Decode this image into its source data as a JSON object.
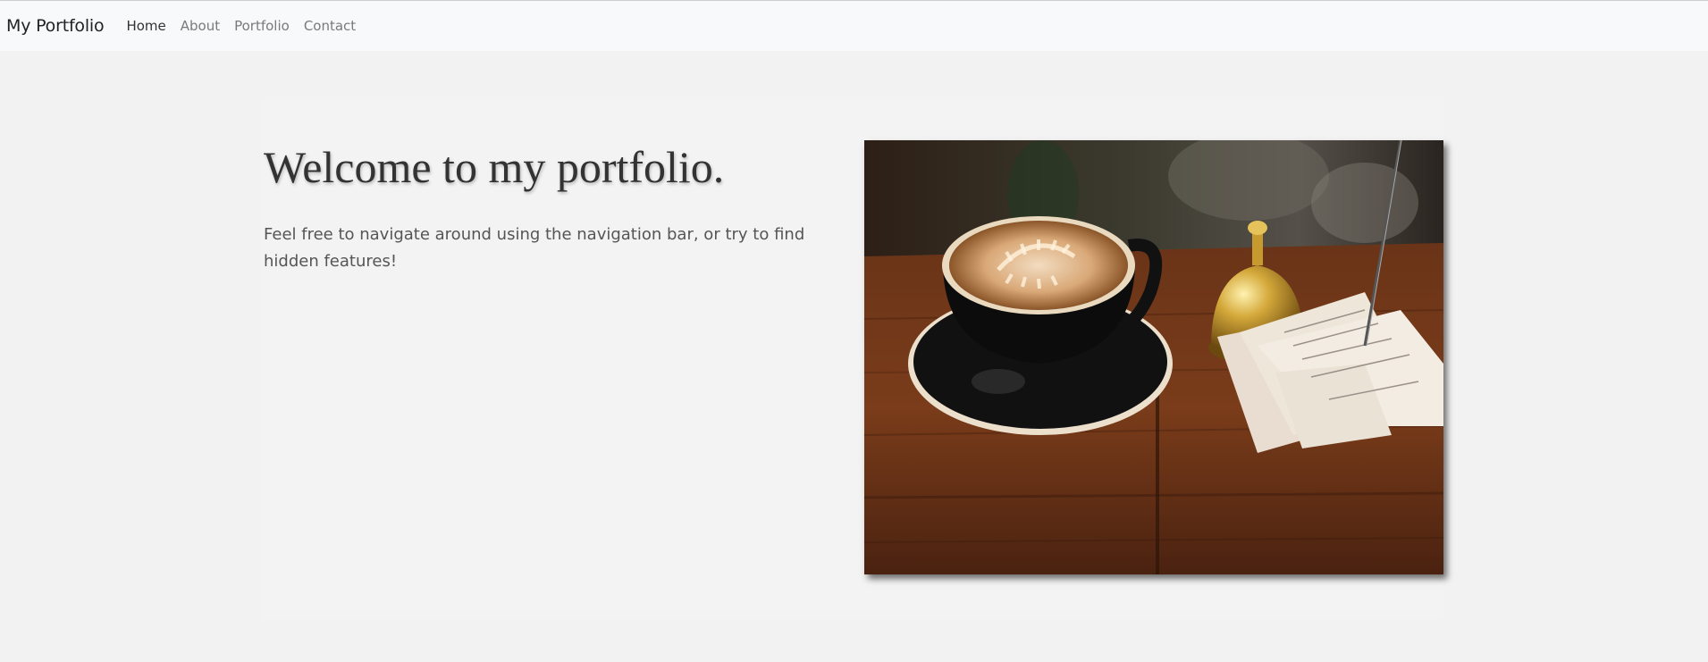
{
  "navbar": {
    "brand": "My Portfolio",
    "links": [
      {
        "label": "Home",
        "active": true
      },
      {
        "label": "About",
        "active": false
      },
      {
        "label": "Portfolio",
        "active": false
      },
      {
        "label": "Contact",
        "active": false
      }
    ]
  },
  "hero": {
    "title": "Welcome to my portfolio.",
    "lead": "Feel free to navigate around using the navigation bar, or try to find hidden features!"
  },
  "colors": {
    "page_bg": "#f2f2f2",
    "navbar_bg": "#f8f9fa",
    "text_dark": "#333333",
    "text_muted": "#7a7a7a"
  }
}
